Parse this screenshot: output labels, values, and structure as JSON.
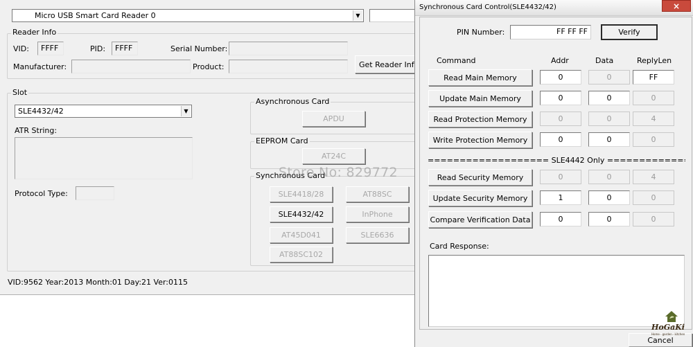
{
  "main_window": {
    "reader_select": "Micro USB Smart Card Reader 0",
    "reader_info": {
      "title": "Reader Info",
      "vid_label": "VID:",
      "vid": "FFFF",
      "pid_label": "PID:",
      "pid": "FFFF",
      "serial_label": "Serial Number:",
      "serial": "",
      "manufacturer_label": "Manufacturer:",
      "manufacturer": "",
      "product_label": "Product:",
      "product": "",
      "get_info_button": "Get Reader Inf"
    },
    "slot": {
      "title": "Slot",
      "card_type": "SLE4432/42",
      "atr_label": "ATR String:",
      "protocol_label": "Protocol Type:",
      "async_group": {
        "title": "Asynchronous Card",
        "button": "APDU"
      },
      "eeprom_group": {
        "title": "EEPROM Card",
        "button": "AT24C"
      },
      "sync_group": {
        "title": "Synchronous Card",
        "buttons": [
          "SLE4418/28",
          "AT88SC",
          "SLE4432/42",
          "InPhone",
          "AT45D041",
          "SLE6636",
          "AT88SC102"
        ]
      }
    },
    "status": "VID:9562 Year:2013 Month:01 Day:21 Ver:0115"
  },
  "watermark": "Store No: 829772",
  "dialog": {
    "title": "Synchronous Card Control(SLE4432/42)",
    "close_glyph": "×",
    "pin_label": "PIN Number:",
    "pin_value": "FF FF FF",
    "verify_button": "Verify",
    "headers": {
      "command": "Command",
      "addr": "Addr",
      "data": "Data",
      "replylen": "ReplyLen"
    },
    "rows": [
      {
        "label": "Read Main Memory",
        "addr": "0",
        "data": "0",
        "replylen": "FF"
      },
      {
        "label": "Update Main Memory",
        "addr": "0",
        "data": "0",
        "replylen": "0"
      },
      {
        "label": "Read Protection Memory",
        "addr": "0",
        "data": "0",
        "replylen": "4"
      },
      {
        "label": "Write Protection Memory",
        "addr": "0",
        "data": "0",
        "replylen": "0"
      }
    ],
    "separator": "=================== SLE4442 Only ==================",
    "rows_4442": [
      {
        "label": "Read Security Memory",
        "addr": "0",
        "data": "0",
        "replylen": "4"
      },
      {
        "label": "Update Security Memory",
        "addr": "1",
        "data": "0",
        "replylen": "0"
      },
      {
        "label": "Compare Verification Data",
        "addr": "0",
        "data": "0",
        "replylen": "0"
      }
    ],
    "response_label": "Card Response:",
    "response": "",
    "cancel_button": "Cancel"
  },
  "logo": {
    "name": "HoGaKi",
    "tagline": "Home · garden · kitchen"
  }
}
